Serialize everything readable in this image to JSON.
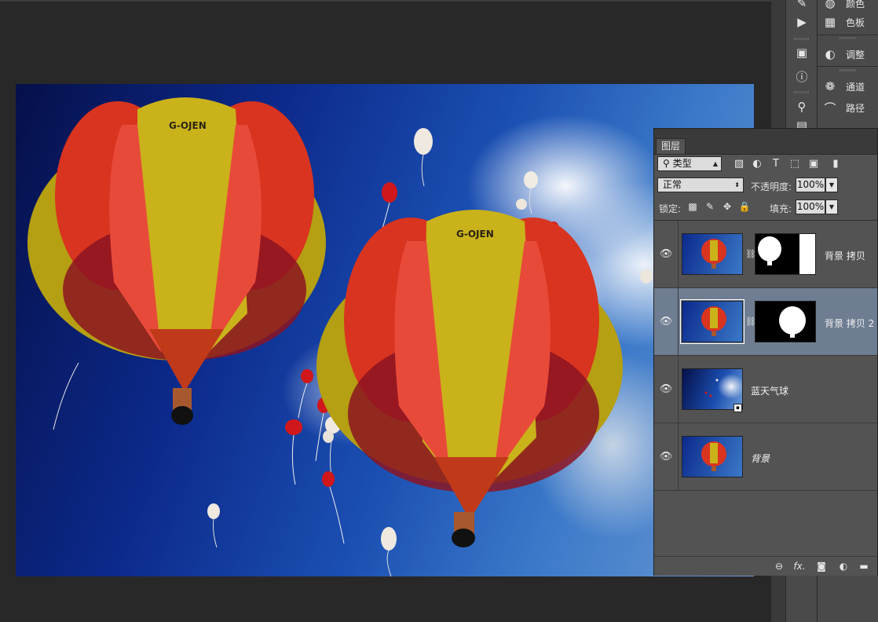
{
  "dock_left": {
    "icons": [
      "history-brush-icon",
      "play-icon",
      "properties-icon",
      "info-icon",
      "brush-tool-icon"
    ]
  },
  "dock_right": {
    "items": [
      {
        "icon": "color-icon",
        "label": "颜色"
      },
      {
        "icon": "swatches-icon",
        "label": "色板"
      },
      {
        "icon": "adjustments-icon",
        "label": "调整"
      },
      {
        "icon": "channels-icon",
        "label": "通道"
      },
      {
        "icon": "paths-icon",
        "label": "路径"
      }
    ]
  },
  "canvas": {
    "balloon_text": "G-OJEN"
  },
  "layers_panel": {
    "tab_label": "图层",
    "filter": {
      "value": "类型",
      "icon": "search-icon"
    },
    "filter_icons": [
      "image-filter-icon",
      "adjustment-filter-icon",
      "type-filter-icon",
      "shape-filter-icon",
      "smart-object-filter-icon",
      "filter-toggle-icon"
    ],
    "blend_mode": "正常",
    "opacity_label": "不透明度:",
    "opacity_value": "100%",
    "lock_label": "锁定:",
    "lock_icons": [
      "lock-transparent-icon",
      "lock-image-icon",
      "lock-position-icon",
      "lock-all-icon"
    ],
    "fill_label": "填充:",
    "fill_value": "100%",
    "layers": [
      {
        "name": "背景 拷贝",
        "visible": true,
        "selected": false,
        "has_mask": true
      },
      {
        "name": "背景 拷贝 2",
        "visible": true,
        "selected": true,
        "has_mask": true
      },
      {
        "name": "蓝天气球",
        "visible": true,
        "selected": false,
        "has_mask": false,
        "smart_object": true
      },
      {
        "name": "背景",
        "visible": true,
        "selected": false,
        "has_mask": false
      }
    ],
    "bottom_icons": [
      "link-layers-icon",
      "fx-icon",
      "add-mask-icon",
      "adjustment-layer-icon",
      "new-group-icon"
    ],
    "fx_label": "fx."
  },
  "colors": {
    "panel_bg": "#535353",
    "selected_layer": "#6e7d91",
    "workspace_bg": "#282828"
  }
}
